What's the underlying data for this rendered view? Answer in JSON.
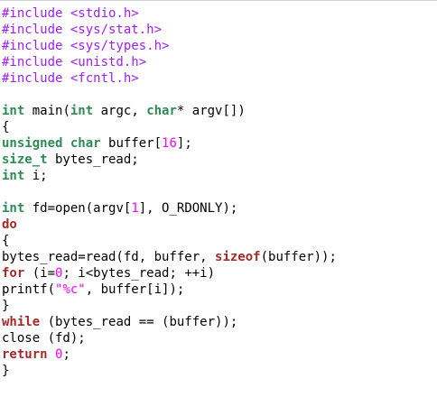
{
  "theme": {
    "background": "#ffffff",
    "preprocessor": "#a020f0",
    "type": "#2e8b57",
    "keyword": "#a52a2a",
    "constant": "#ff00ff",
    "text": "#000000"
  },
  "code_lines": [
    [
      {
        "t": "pre",
        "s": "#include <stdio.h>"
      }
    ],
    [
      {
        "t": "pre",
        "s": "#include <sys/stat.h>"
      }
    ],
    [
      {
        "t": "pre",
        "s": "#include <sys/types.h>"
      }
    ],
    [
      {
        "t": "pre",
        "s": "#include <unistd.h>"
      }
    ],
    [
      {
        "t": "pre",
        "s": "#include <fcntl.h>"
      }
    ],
    [],
    [
      {
        "t": "type",
        "s": "int"
      },
      {
        "t": "plain",
        "s": " main("
      },
      {
        "t": "type",
        "s": "int"
      },
      {
        "t": "plain",
        "s": " argc, "
      },
      {
        "t": "type",
        "s": "char"
      },
      {
        "t": "plain",
        "s": "* argv[])"
      }
    ],
    [
      {
        "t": "plain",
        "s": "{"
      }
    ],
    [
      {
        "t": "type",
        "s": "unsigned"
      },
      {
        "t": "plain",
        "s": " "
      },
      {
        "t": "type",
        "s": "char"
      },
      {
        "t": "plain",
        "s": " buffer["
      },
      {
        "t": "num",
        "s": "16"
      },
      {
        "t": "plain",
        "s": "];"
      }
    ],
    [
      {
        "t": "type",
        "s": "size_t"
      },
      {
        "t": "plain",
        "s": " bytes_read;"
      }
    ],
    [
      {
        "t": "type",
        "s": "int"
      },
      {
        "t": "plain",
        "s": " i;"
      }
    ],
    [],
    [
      {
        "t": "type",
        "s": "int"
      },
      {
        "t": "plain",
        "s": " fd=open(argv["
      },
      {
        "t": "num",
        "s": "1"
      },
      {
        "t": "plain",
        "s": "], O_RDONLY);"
      }
    ],
    [
      {
        "t": "kw",
        "s": "do"
      }
    ],
    [
      {
        "t": "plain",
        "s": "{"
      }
    ],
    [
      {
        "t": "plain",
        "s": "bytes_read=read(fd, buffer, "
      },
      {
        "t": "kw",
        "s": "sizeof"
      },
      {
        "t": "plain",
        "s": "(buffer));"
      }
    ],
    [
      {
        "t": "kw",
        "s": "for"
      },
      {
        "t": "plain",
        "s": " (i="
      },
      {
        "t": "num",
        "s": "0"
      },
      {
        "t": "plain",
        "s": "; i<bytes_read; ++i)"
      }
    ],
    [
      {
        "t": "plain",
        "s": "printf("
      },
      {
        "t": "str",
        "s": "\"%c\""
      },
      {
        "t": "plain",
        "s": ", buffer[i]);"
      }
    ],
    [
      {
        "t": "plain",
        "s": "}"
      }
    ],
    [
      {
        "t": "kw",
        "s": "while"
      },
      {
        "t": "plain",
        "s": " (bytes_read == (buffer));"
      }
    ],
    [
      {
        "t": "plain",
        "s": "close (fd);"
      }
    ],
    [
      {
        "t": "kw",
        "s": "return"
      },
      {
        "t": "plain",
        "s": " "
      },
      {
        "t": "num",
        "s": "0"
      },
      {
        "t": "plain",
        "s": ";"
      }
    ],
    [
      {
        "t": "plain",
        "s": "}"
      }
    ]
  ]
}
